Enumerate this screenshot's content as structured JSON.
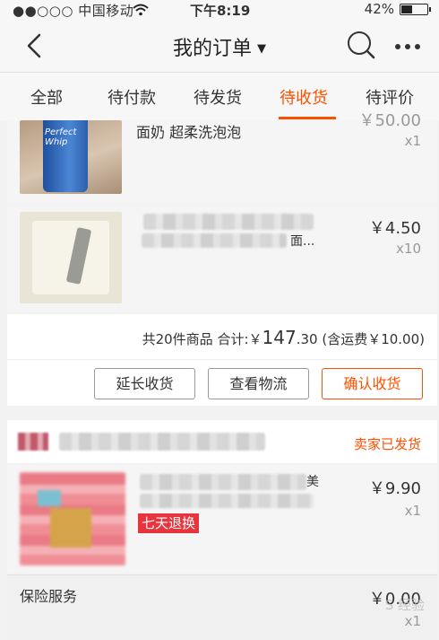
{
  "status_bar": {
    "carrier": "●●○○○ 中国移动",
    "wifi_icon": "wifi-icon",
    "time": "下午8:19",
    "battery": "42%",
    "battery_level": 0.42
  },
  "nav": {
    "title": "我的订单",
    "caret": "▼"
  },
  "tabs": [
    {
      "label": "全部"
    },
    {
      "label": "待付款"
    },
    {
      "label": "待发货"
    },
    {
      "label": "待收货"
    },
    {
      "label": "待评价"
    }
  ],
  "order1": {
    "items": [
      {
        "name_partial": "面奶 超柔洗泡泡",
        "price": "￥50.00",
        "qty": "x1",
        "thumb_text": "Perfect Whip"
      },
      {
        "name_partial": "面...",
        "price": "￥4.50",
        "qty": "x10"
      }
    ],
    "summary": {
      "prefix": "共20件商品 合计:￥",
      "amount_main": "147",
      "amount_decimal": ".30",
      "suffix": "(含运费￥10.00)"
    },
    "actions": {
      "extend": "延长收货",
      "logistics": "查看物流",
      "confirm": "确认收货"
    }
  },
  "order2": {
    "shop_status": "卖家已发货",
    "item": {
      "name_partial": "美",
      "price": "￥9.90",
      "qty": "x1",
      "tag": "七天退换"
    },
    "service": {
      "label": "保险服务",
      "price": "￥0.00",
      "qty": "x1"
    }
  },
  "watermark": "S 经验"
}
